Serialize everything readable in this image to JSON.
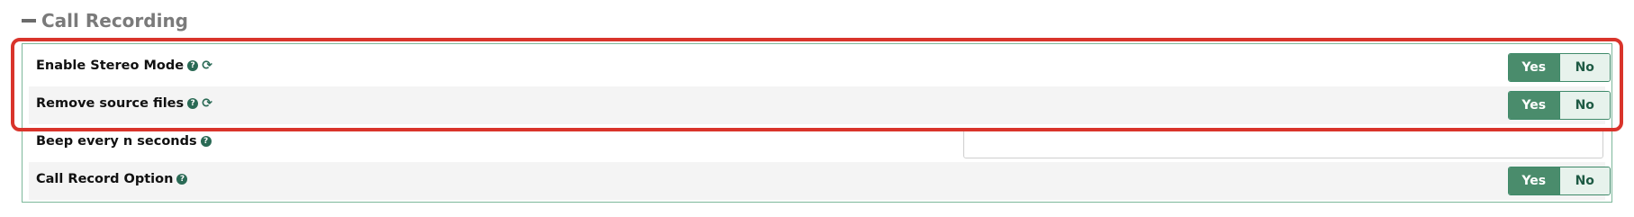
{
  "section": {
    "title": "Call Recording",
    "collapse_icon": "minus-icon"
  },
  "rows": [
    {
      "label": "Enable Stereo Mode",
      "has_sync": true,
      "control": "toggle",
      "yes": "Yes",
      "no": "No",
      "selected": "Yes"
    },
    {
      "label": "Remove source files",
      "has_sync": true,
      "control": "toggle",
      "yes": "Yes",
      "no": "No",
      "selected": "Yes"
    },
    {
      "label": "Beep every n seconds",
      "has_sync": false,
      "control": "text",
      "value": ""
    },
    {
      "label": "Call Record Option",
      "has_sync": false,
      "control": "toggle",
      "yes": "Yes",
      "no": "No",
      "selected": "Yes"
    }
  ],
  "icons": {
    "help": "question-circle-icon",
    "sync": "refresh-icon",
    "help_glyph": "?",
    "sync_glyph": "⟳"
  },
  "colors": {
    "toggle_active": "#4a8c6c",
    "toggle_inactive": "#e7f2ec",
    "panel_border": "#7cb89a",
    "highlight": "#d9342b"
  }
}
